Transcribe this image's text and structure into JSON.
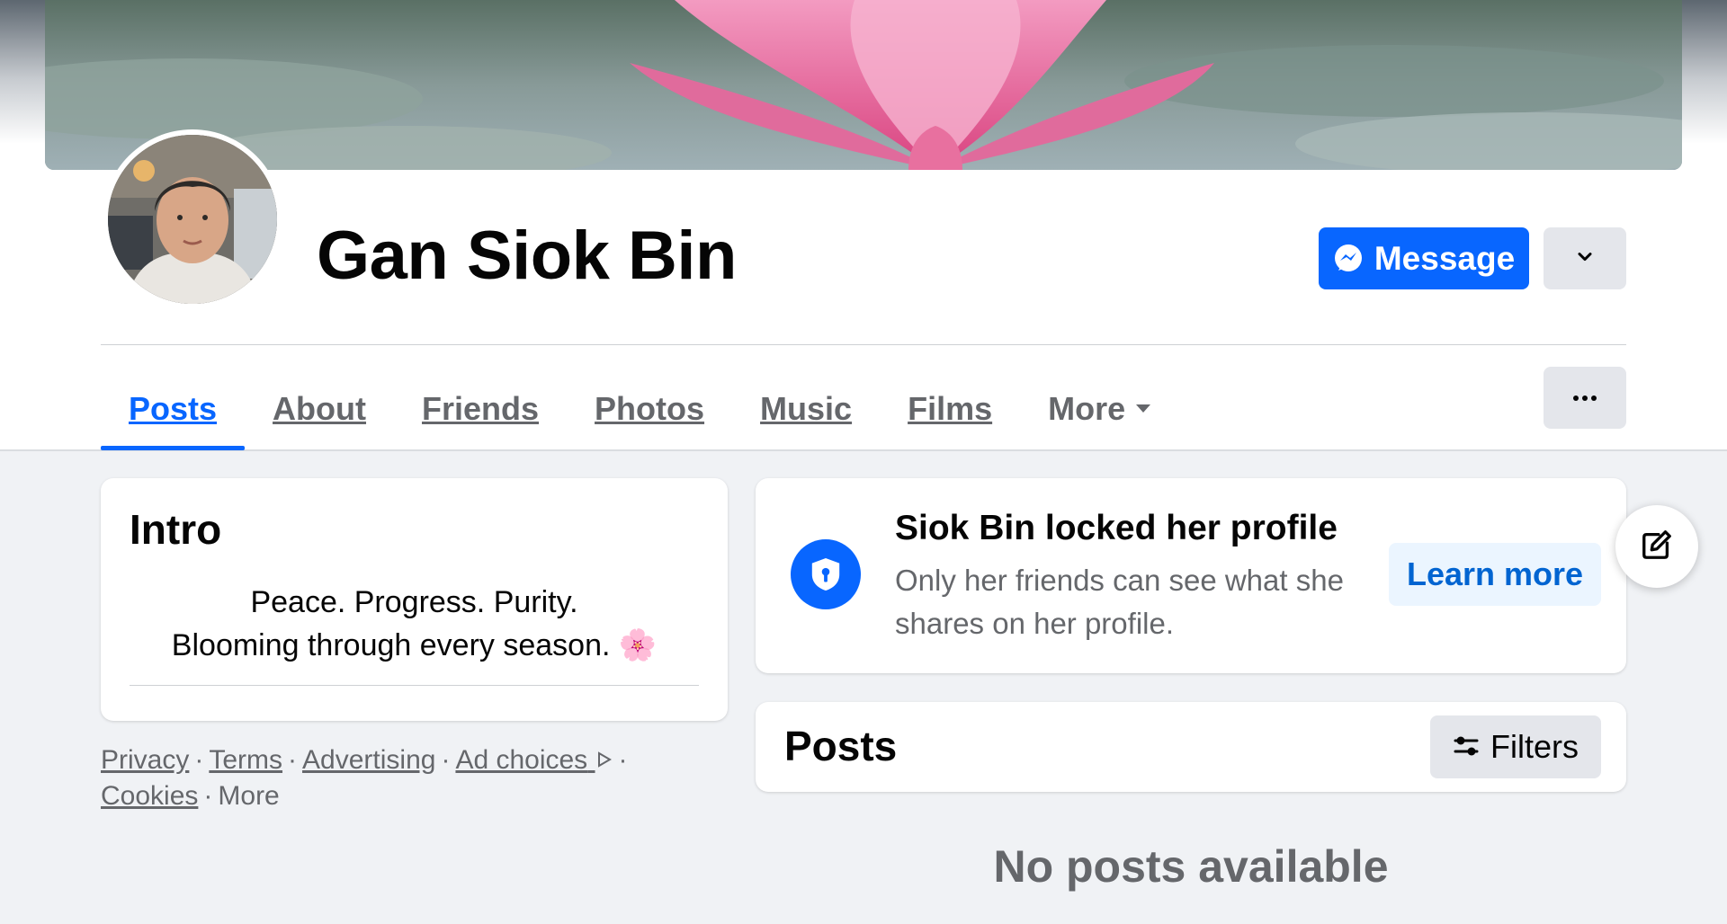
{
  "profile": {
    "name": "Gan Siok Bin",
    "cover_icon": "pink-water-lily-photo",
    "avatar_icon": "profile-photo"
  },
  "actions": {
    "message_label": "Message",
    "message_icon": "messenger-icon",
    "dropdown_icon": "chevron-down-icon",
    "more_options_icon": "ellipsis-icon"
  },
  "tabs": [
    {
      "label": "Posts",
      "active": true
    },
    {
      "label": "About",
      "active": false
    },
    {
      "label": "Friends",
      "active": false
    },
    {
      "label": "Photos",
      "active": false
    },
    {
      "label": "Music",
      "active": false
    },
    {
      "label": "Films",
      "active": false
    },
    {
      "label": "More",
      "active": false
    }
  ],
  "intro": {
    "title": "Intro",
    "bio_line1": "Peace. Progress. Purity.",
    "bio_line2": "Blooming through every season. 🌸"
  },
  "footer": {
    "links": [
      "Privacy",
      "Terms",
      "Advertising",
      "Ad choices",
      "Cookies"
    ],
    "more_label": "More"
  },
  "locked_notice": {
    "title": "Siok Bin locked her profile",
    "description": "Only her friends can see what she shares on her profile.",
    "learn_more_label": "Learn more",
    "icon": "shield-lock-icon"
  },
  "posts": {
    "title": "Posts",
    "filters_label": "Filters",
    "filters_icon": "sliders-icon",
    "empty_message": "No posts available"
  },
  "fab": {
    "icon": "edit-icon"
  },
  "colors": {
    "accent": "#0866ff",
    "background": "#f0f2f5",
    "secondary_text": "#65676b",
    "button_gray": "#e4e6eb"
  }
}
